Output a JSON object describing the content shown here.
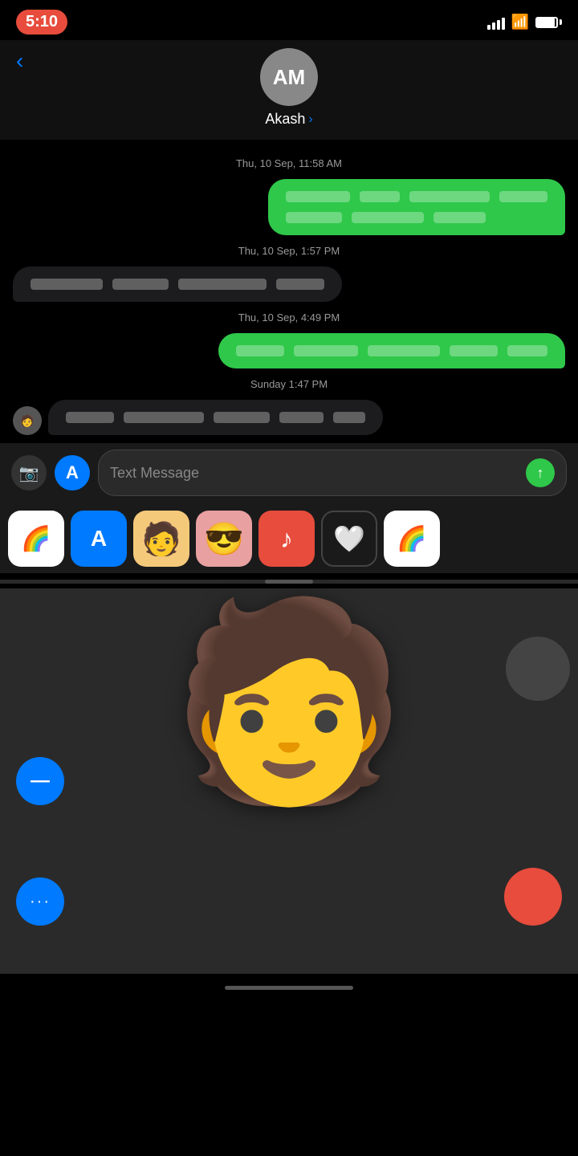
{
  "statusBar": {
    "time": "5:10",
    "signalBars": [
      6,
      9,
      12,
      15
    ],
    "wifiSymbol": "wifi",
    "batteryLevel": 90
  },
  "header": {
    "backLabel": "‹",
    "avatarInitials": "AM",
    "contactName": "Akash",
    "chevron": "›"
  },
  "messages": [
    {
      "type": "timestamp",
      "text": "Thu, 10 Sep, 11:58 AM"
    },
    {
      "type": "sent",
      "blurLines": [
        [
          80,
          50,
          100,
          60
        ],
        [
          70,
          90,
          65
        ]
      ]
    },
    {
      "type": "timestamp",
      "text": "Thu, 10 Sep, 1:57 PM"
    },
    {
      "type": "received",
      "blurLines": [
        [
          90,
          70,
          110,
          60
        ]
      ]
    },
    {
      "type": "timestamp",
      "text": "Thu, 10 Sep, 4:49 PM"
    },
    {
      "type": "sent",
      "blurLines": [
        [
          70,
          80,
          90,
          60,
          50
        ]
      ]
    },
    {
      "type": "timestamp",
      "text": "Sunday 1:47 PM"
    },
    {
      "type": "received_icon",
      "blurLines": [
        [
          60,
          100,
          70,
          55,
          40
        ]
      ]
    }
  ],
  "inputBar": {
    "cameraIcon": "📷",
    "appstoreIcon": "A",
    "placeholder": "Text Message",
    "sendIcon": "↑"
  },
  "appIconsRow": {
    "icons": [
      {
        "label": "Photos",
        "emoji": "🌈",
        "type": "photos"
      },
      {
        "label": "App Store",
        "emoji": "A",
        "type": "appstore"
      },
      {
        "label": "Memoji 1",
        "emoji": "🧑",
        "type": "memoji1"
      },
      {
        "label": "Memoji 2",
        "emoji": "😎",
        "type": "memoji2"
      },
      {
        "label": "Music",
        "emoji": "♪",
        "type": "music"
      },
      {
        "label": "Heart App",
        "emoji": "🤍",
        "type": "heart"
      },
      {
        "label": "Photos 2",
        "emoji": "🌈",
        "type": "photos2"
      }
    ]
  },
  "memojiArea": {
    "emoji": "🧑",
    "blueButtonIcon": "—",
    "dotsLabel": "···",
    "recordLabel": ""
  },
  "homeIndicator": {
    "label": ""
  }
}
